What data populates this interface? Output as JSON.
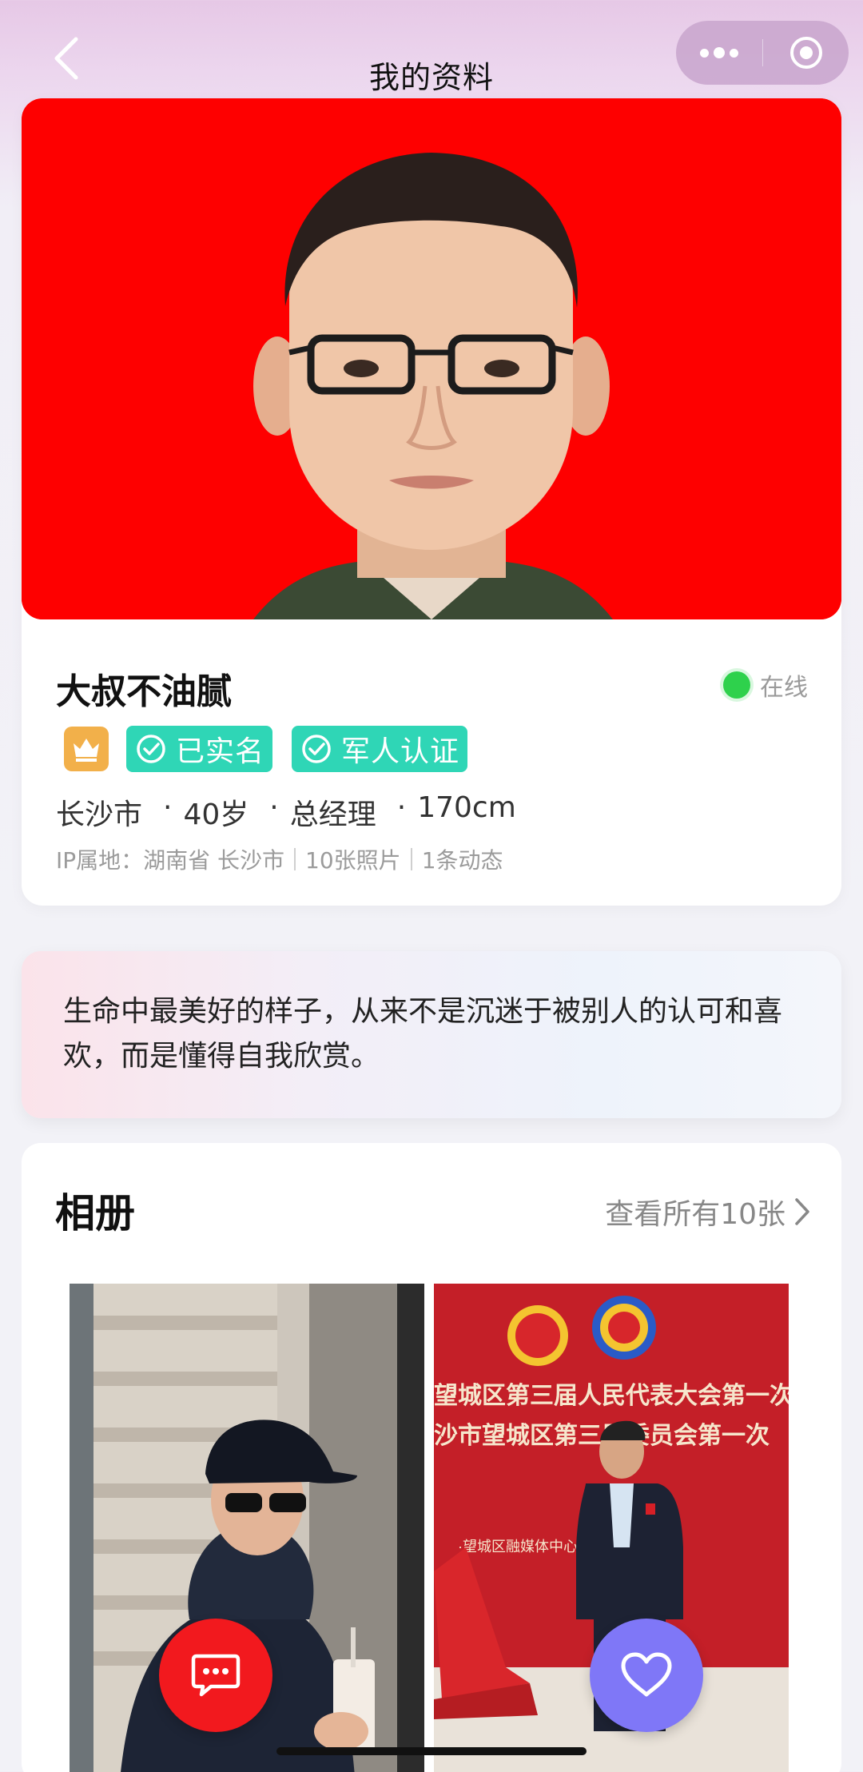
{
  "nav": {
    "title": "我的资料",
    "back_icon": "chevron-left-icon",
    "more_icon": "more-dots-icon",
    "close_icon": "target-circle-icon"
  },
  "profile": {
    "nickname": "大叔不油腻",
    "status": "在线",
    "status_color": "#2ed14c",
    "badges": {
      "vip_icon": "crown-icon",
      "real_name": "已实名",
      "military": "军人认证"
    },
    "meta": {
      "city": "长沙市",
      "age": "40岁",
      "job": "总经理",
      "height": "170cm"
    },
    "ip_line": {
      "location": "IP属地：湖南省 长沙市",
      "photos": "10张照片",
      "moments": "1条动态"
    }
  },
  "bio": {
    "text": "生命中最美好的样子，从来不是沉迷于被别人的认可和喜欢，而是懂得自我欣赏。"
  },
  "album": {
    "title": "相册",
    "view_all": "查看所有10张",
    "photos": [
      {
        "name": "photo-man-in-cap-hoodie"
      },
      {
        "name": "photo-man-at-conference"
      }
    ],
    "banner_line1": "望城区第三届人民代表大会第一次",
    "banner_line2": "沙市望城区第三届委员会第一次",
    "banner_line3": "·望城区融媒体中心"
  },
  "actions": {
    "chat_icon": "chat-bubble-icon",
    "like_icon": "heart-icon"
  },
  "colors": {
    "photo_bg": "#fe0000",
    "verify_badge": "#2fd6b6",
    "crown_badge": "#f2b04a",
    "chat_button": "#f2191e",
    "like_button": "#7f77f7"
  }
}
